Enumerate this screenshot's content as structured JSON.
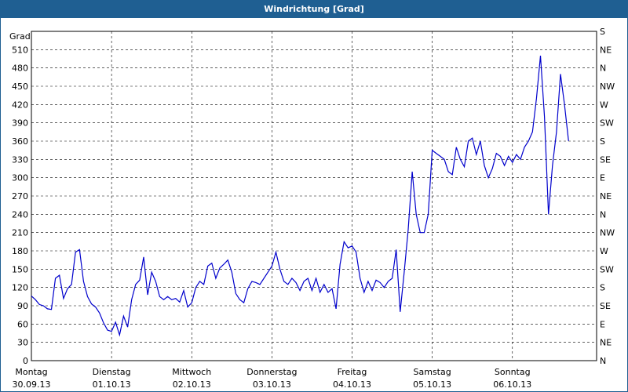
{
  "window": {
    "title": "Windrichtung [Grad]"
  },
  "chart_data": {
    "type": "line",
    "title": "Windrichtung [Grad]",
    "ylabel": "Grad",
    "ylim": [
      0,
      540
    ],
    "y_ticks": [
      0,
      30,
      60,
      90,
      120,
      150,
      180,
      210,
      240,
      270,
      300,
      330,
      360,
      390,
      420,
      450,
      480,
      510
    ],
    "right_axis_labels": [
      "N",
      "NE",
      "E",
      "SE",
      "S",
      "SW",
      "W",
      "NW",
      "N",
      "NE",
      "E",
      "SE",
      "S"
    ],
    "right_axis_ticks": [
      0,
      30,
      60,
      90,
      120,
      150,
      180,
      210,
      240,
      270,
      300,
      330,
      360,
      390,
      420,
      450,
      480,
      510,
      540
    ],
    "right_axis_labels_full": [
      "N",
      "NE",
      "E",
      "SE",
      "S",
      "SW",
      "W",
      "NW",
      "N",
      "NE",
      "E",
      "SE",
      "S",
      "SW",
      "W",
      "NW",
      "N",
      "NE",
      "S"
    ],
    "x_axis": {
      "days": [
        {
          "name": "Montag",
          "date": "30.09.13"
        },
        {
          "name": "Dienstag",
          "date": "01.10.13"
        },
        {
          "name": "Mittwoch",
          "date": "02.10.13"
        },
        {
          "name": "Donnerstag",
          "date": "03.10.13"
        },
        {
          "name": "Freitag",
          "date": "04.10.13"
        },
        {
          "name": "Samstag",
          "date": "05.10.13"
        },
        {
          "name": "Sonntag",
          "date": "06.10.13"
        }
      ]
    },
    "grid": true,
    "series": [
      {
        "color": "#0000cc",
        "x_days": [
          0.0,
          0.05,
          0.1,
          0.15,
          0.2,
          0.25,
          0.3,
          0.35,
          0.4,
          0.45,
          0.5,
          0.55,
          0.6,
          0.65,
          0.7,
          0.75,
          0.8,
          0.85,
          0.9,
          0.95,
          1.0,
          1.05,
          1.1,
          1.15,
          1.2,
          1.25,
          1.3,
          1.35,
          1.4,
          1.45,
          1.5,
          1.55,
          1.6,
          1.65,
          1.7,
          1.75,
          1.8,
          1.85,
          1.9,
          1.95,
          2.0,
          2.05,
          2.1,
          2.15,
          2.2,
          2.25,
          2.3,
          2.35,
          2.4,
          2.45,
          2.5,
          2.55,
          2.6,
          2.65,
          2.7,
          2.75,
          2.8,
          2.85,
          2.9,
          2.95,
          3.0,
          3.05,
          3.1,
          3.15,
          3.2,
          3.25,
          3.3,
          3.35,
          3.4,
          3.45,
          3.5,
          3.55,
          3.6,
          3.65,
          3.7,
          3.75,
          3.8,
          3.85,
          3.9,
          3.95,
          4.0,
          4.05,
          4.1,
          4.15,
          4.2,
          4.25,
          4.3,
          4.35,
          4.4,
          4.45,
          4.5,
          4.55,
          4.6,
          4.65,
          4.7,
          4.75,
          4.8,
          4.85,
          4.9,
          4.95,
          5.0,
          5.05,
          5.1,
          5.15,
          5.2,
          5.25,
          5.3,
          5.35,
          5.4,
          5.45,
          5.5,
          5.55,
          5.6,
          5.65,
          5.7,
          5.75,
          5.8,
          5.85,
          5.9,
          5.95,
          6.0,
          6.05,
          6.1,
          6.15,
          6.2,
          6.25,
          6.3,
          6.35,
          6.4,
          6.45,
          6.5,
          6.55,
          6.6,
          6.65,
          6.7,
          6.75,
          6.8,
          6.85,
          6.9,
          6.95,
          7.0
        ],
        "values": [
          106,
          100,
          92,
          90,
          85,
          84,
          135,
          140,
          102,
          118,
          125,
          178,
          182,
          130,
          105,
          93,
          88,
          78,
          62,
          50,
          48,
          63,
          42,
          73,
          55,
          100,
          125,
          132,
          170,
          108,
          145,
          130,
          105,
          100,
          105,
          100,
          102,
          96,
          115,
          88,
          95,
          120,
          130,
          125,
          155,
          160,
          135,
          152,
          158,
          165,
          145,
          110,
          100,
          95,
          118,
          130,
          128,
          125,
          135,
          145,
          155,
          178,
          150,
          130,
          125,
          135,
          128,
          115,
          130,
          135,
          115,
          135,
          112,
          125,
          112,
          118,
          85,
          158,
          195,
          185,
          188,
          178,
          135,
          112,
          130,
          115,
          132,
          128,
          120,
          130,
          135,
          182,
          80,
          145,
          215,
          310,
          240,
          210,
          210,
          240,
          345,
          340,
          335,
          330,
          310,
          305,
          350,
          330,
          318,
          360,
          365,
          338,
          360,
          320,
          300,
          315,
          340,
          335,
          320,
          335,
          325,
          338,
          330,
          350,
          360,
          375,
          430,
          500,
          400,
          240,
          320,
          375,
          470,
          420,
          360
        ],
        "name": ""
      }
    ]
  }
}
